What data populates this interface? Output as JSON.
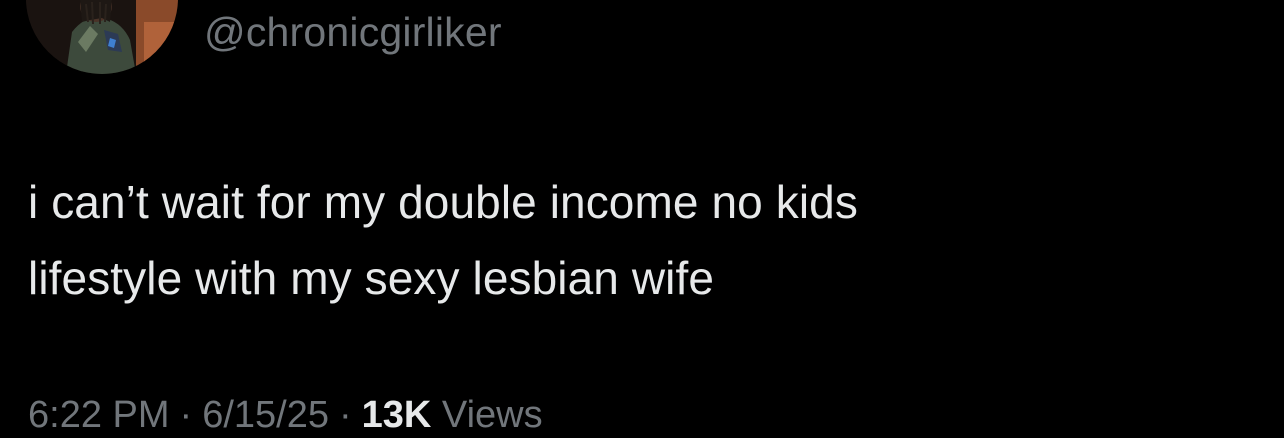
{
  "tweet": {
    "handle": "@chronicgirliker",
    "text_lines": [
      "i can’t wait for my double income no kids",
      "lifestyle with my sexy lesbian wife"
    ],
    "time": "6:22 PM",
    "separator": "·",
    "date": "6/15/25",
    "views_count": "13K",
    "views_label": "Views"
  },
  "colors": {
    "background": "#000000",
    "primary_text": "#e7e9ea",
    "secondary_text": "#71767b"
  },
  "icons": {
    "avatar": "profile-photo"
  }
}
